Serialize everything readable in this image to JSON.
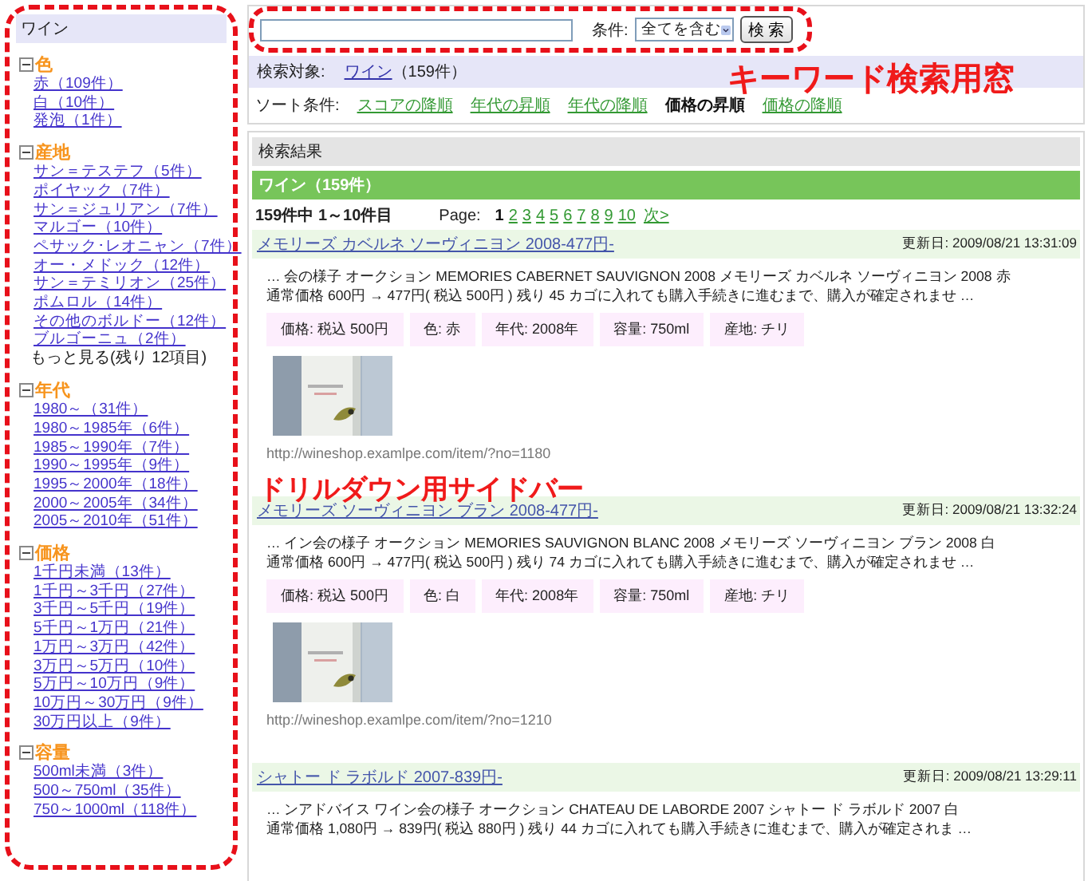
{
  "sidebar": {
    "title": "ワイン",
    "groups": [
      {
        "label": "色",
        "expanded": true,
        "items": [
          "赤（109件）",
          "白（10件）",
          "発泡（1件）"
        ]
      },
      {
        "label": "産地",
        "expanded": true,
        "items": [
          "サン＝テステフ（5件）",
          "ポイヤック（7件）",
          "サン＝ジュリアン（7件）",
          "マルゴー（10件）",
          "ペサック･レオニャン（7件）",
          "オー・メドック（12件）",
          "サン＝テミリオン（25件）",
          "ポムロル（14件）",
          "その他のボルドー（12件）",
          "ブルゴーニュ（2件）"
        ],
        "more": "もっと見る(残り 12項目)"
      },
      {
        "label": "年代",
        "expanded": true,
        "items": [
          "1980～（31件）",
          "1980～1985年（6件）",
          "1985～1990年（7件）",
          "1990～1995年（9件）",
          "1995～2000年（18件）",
          "2000～2005年（34件）",
          "2005～2010年（51件）"
        ]
      },
      {
        "label": "価格",
        "expanded": true,
        "items": [
          "1千円未満（13件）",
          "1千円～3千円（27件）",
          "3千円～5千円（19件）",
          "5千円～1万円（21件）",
          "1万円～3万円（42件）",
          "3万円～5万円（10件）",
          "5万円～10万円（9件）",
          "10万円～30万円（9件）",
          "30万円以上（9件）"
        ]
      },
      {
        "label": "容量",
        "expanded": true,
        "items": [
          "500ml未満（3件）",
          "500～750ml（35件）",
          "750～1000ml（118件）"
        ]
      }
    ]
  },
  "search": {
    "condition_label": "条件:",
    "condition": "全てを含む",
    "button": "検 索"
  },
  "target": {
    "label": "検索対象:",
    "link": "ワイン",
    "count": "（159件）"
  },
  "sort": {
    "label": "ソート条件:",
    "options": [
      {
        "label": "スコアの降順",
        "selected": false
      },
      {
        "label": "年代の昇順",
        "selected": false
      },
      {
        "label": "年代の降順",
        "selected": false
      },
      {
        "label": "価格の昇順",
        "selected": true
      },
      {
        "label": "価格の降順",
        "selected": false
      }
    ]
  },
  "results": {
    "header": "検索結果",
    "category": "ワイン（159件）",
    "range": "159件中 1～10件目",
    "page_label": "Page:",
    "pages": [
      {
        "label": "1",
        "selected": true
      },
      {
        "label": "2",
        "selected": false
      },
      {
        "label": "3",
        "selected": false
      },
      {
        "label": "4",
        "selected": false
      },
      {
        "label": "5",
        "selected": false
      },
      {
        "label": "6",
        "selected": false
      },
      {
        "label": "7",
        "selected": false
      },
      {
        "label": "8",
        "selected": false
      },
      {
        "label": "9",
        "selected": false
      },
      {
        "label": "10",
        "selected": false
      }
    ],
    "next": "次>",
    "items": [
      {
        "title": "メモリーズ カベルネ ソーヴィニヨン 2008-477円-",
        "updated": "更新日: 2009/08/21 13:31:09",
        "description": [
          "… 会の様子 オークション MEMORIES CABERNET SAUVIGNON 2008 メモリーズ カベルネ ソーヴィニヨン 2008 赤",
          "通常価格 600円 → 477円( 税込 500円 ) 残り 45 カゴに入れても購入手続きに進むまで、購入が確定されませ …"
        ],
        "tags": [
          "価格: 税込 500円",
          "色: 赤",
          "年代: 2008年",
          "容量: 750ml",
          "産地: チリ"
        ],
        "image": {
          "kind": "picture"
        },
        "url": "http://wineshop.examlpe.com/item/?no=1180"
      },
      {
        "title": "メモリーズ ソーヴィニヨン ブラン 2008-477円-",
        "updated": "更新日: 2009/08/21 13:32:24",
        "description": [
          "… イン会の様子 オークション MEMORIES SAUVIGNON BLANC 2008 メモリーズ ソーヴィニヨン ブラン 2008 白",
          "通常価格 600円 → 477円( 税込 500円 ) 残り 74 カゴに入れても購入手続きに進むまで、購入が確定されませ …"
        ],
        "tags": [
          "価格: 税込 500円",
          "色: 白",
          "年代: 2008年",
          "容量: 750ml",
          "産地: チリ"
        ],
        "image": {
          "kind": "picture"
        },
        "url": "http://wineshop.examlpe.com/item/?no=1210"
      },
      {
        "title": "シャトー ド ラボルド 2007-839円-",
        "updated": "更新日: 2009/08/21 13:29:11",
        "description": [
          "… ンアドバイス ワイン会の様子 オークション CHATEAU DE LABORDE 2007 シャトー ド ラボルド 2007 白",
          "通常価格 1,080円 → 839円( 税込 880円 ) 残り 44 カゴに入れても購入手続きに進むまで、購入が確定されま …"
        ]
      }
    ]
  },
  "callouts": {
    "search": "キーワード検索用窓",
    "sidebar": "ドリルダウン用サイドバー"
  }
}
